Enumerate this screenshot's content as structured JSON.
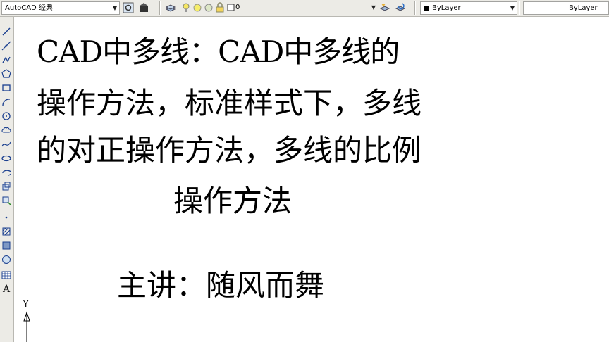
{
  "toolbar": {
    "workspace": "AutoCAD 经典",
    "layer": "0",
    "color": "ByLayer",
    "linetype": "ByLayer"
  },
  "left_tools": [
    "line-icon",
    "construction-line-icon",
    "polyline-icon",
    "polygon-icon",
    "rectangle-icon",
    "arc-icon",
    "circle-icon",
    "revision-cloud-icon",
    "spline-icon",
    "ellipse-icon",
    "ellipse-arc-icon",
    "insert-block-icon",
    "make-block-icon",
    "point-icon",
    "hatch-icon",
    "gradient-icon",
    "region-icon",
    "table-icon",
    "multiline-text-icon"
  ],
  "document": {
    "title_line1": "CAD中多线：CAD中多线的",
    "title_line2": "操作方法，标准样式下，多线",
    "title_line3": "的对正操作方法，多线的比例",
    "title_line4": "操作方法",
    "presenter": "主讲：随风而舞"
  },
  "ucs": {
    "y_label": "Y"
  }
}
